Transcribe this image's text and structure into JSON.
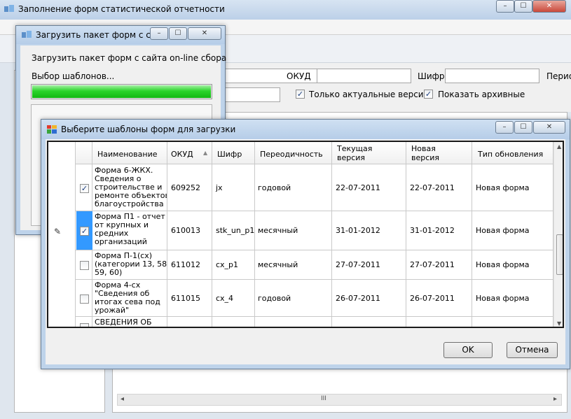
{
  "main_window": {
    "title": "Заполнение форм статистической отчетности",
    "filter": {
      "okud_label": "ОКУД",
      "shifr_label": "Шифр",
      "period_label": "Перио",
      "only_actual_label": "Только актуальные версии",
      "show_archive_label": "Показать архивные"
    }
  },
  "upload_dialog": {
    "title": "Загрузить пакет форм с са...",
    "heading": "Загрузить пакет форм с сайта on-line сбора",
    "status": "Выбор шаблонов...",
    "progress": 1.0
  },
  "templates_dialog": {
    "title": "Выберите шаблоны форм для загрузки",
    "columns": [
      "Наименование",
      "ОКУД",
      "Шифр",
      "Переодичность",
      "Текущая версия",
      "Новая версия",
      "Тип обновления"
    ],
    "rows": [
      {
        "checked": true,
        "name": [
          "Форма 6-ЖКХ.",
          "Сведения о",
          "строительстве и",
          "ремонте объектов",
          "благоустройства"
        ],
        "okud": "609252",
        "shifr": "jx",
        "period": "годовой",
        "current": "22-07-2011",
        "new": "22-07-2011",
        "type": "Новая форма"
      },
      {
        "checked": true,
        "name": [
          "Форма П1 - отчет",
          "от крупных и",
          "средних",
          "организаций"
        ],
        "okud": "610013",
        "shifr": "stk_un_p1",
        "period": "месячный",
        "current": "31-01-2012",
        "new": "31-01-2012",
        "type": "Новая форма"
      },
      {
        "checked": false,
        "name": [
          "Форма П-1(сх)",
          "(категории 13, 58,",
          "59, 60)"
        ],
        "okud": "611012",
        "shifr": "cx_p1",
        "period": "месячный",
        "current": "27-07-2011",
        "new": "27-07-2011",
        "type": "Новая форма"
      },
      {
        "checked": false,
        "name": [
          "Форма 4-сх",
          "\"Сведения об",
          "итогах сева под",
          "урожай\""
        ],
        "okud": "611015",
        "shifr": "cx_4",
        "period": "годовой",
        "current": "26-07-2011",
        "new": "26-07-2011",
        "type": "Новая форма"
      },
      {
        "checked": false,
        "name": [
          "СВЕДЕНИЯ ОБ"
        ],
        "okud": "",
        "shifr": "",
        "period": "",
        "current": "",
        "new": "",
        "type": ""
      }
    ],
    "ok_label": "OK",
    "cancel_label": "Отмена"
  },
  "icons": {
    "checkmark": "✓",
    "pencil": "✎",
    "sort_up": "▲",
    "scroll_up": "▲",
    "scroll_down": "▼",
    "scroll_left": "◂",
    "scroll_right": "▸",
    "scroll_grip": "III"
  }
}
